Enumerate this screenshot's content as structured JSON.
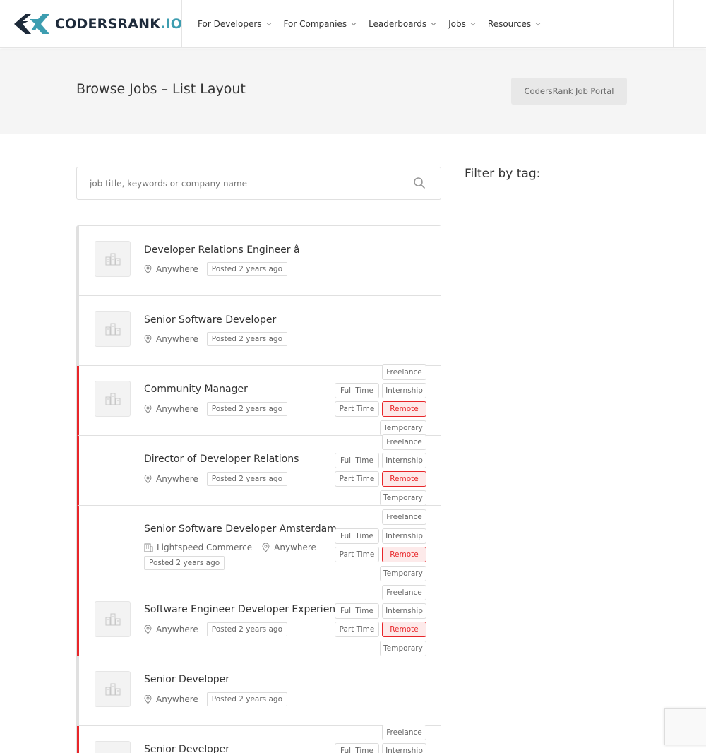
{
  "brand": {
    "name_main": "CODERSRANK",
    "name_suffix": ".IO"
  },
  "nav": [
    {
      "label": "For Developers"
    },
    {
      "label": "For Companies"
    },
    {
      "label": "Leaderboards"
    },
    {
      "label": "Jobs"
    },
    {
      "label": "Resources"
    }
  ],
  "page": {
    "title": "Browse Jobs – List Layout",
    "portal_button": "CodersRank Job Portal",
    "search_placeholder": "job title, keywords or company name",
    "filter_title": "Filter by tag:"
  },
  "tags": {
    "freelance": "Freelance",
    "full_time": "Full Time",
    "internship": "Internship",
    "part_time": "Part Time",
    "remote": "Remote",
    "temporary": "Temporary"
  },
  "colors": {
    "accent_red": "#e8262a",
    "brand_teal": "#3d9db0",
    "brand_navy": "#1d2a3a"
  },
  "jobs": [
    {
      "title": "Developer Relations Engineer â",
      "location": "Anywhere",
      "posted": "Posted 2 years ago",
      "featured": false,
      "has_logo": true
    },
    {
      "title": "Senior Software Developer",
      "location": "Anywhere",
      "posted": "Posted 2 years ago",
      "featured": false,
      "has_logo": true
    },
    {
      "title": "Community Manager",
      "location": "Anywhere",
      "posted": "Posted 2 years ago",
      "featured": true,
      "has_logo": true
    },
    {
      "title": "Director of Developer Relations",
      "location": "Anywhere",
      "posted": "Posted 2 years ago",
      "featured": true,
      "has_logo": false
    },
    {
      "title": "Senior Software Developer Amsterdam",
      "company": "Lightspeed Commerce",
      "location": "Anywhere",
      "posted": "Posted 2 years ago",
      "featured": true,
      "has_logo": false
    },
    {
      "title": "Software Engineer Developer Experience",
      "location": "Anywhere",
      "posted": "Posted 2 years ago",
      "featured": true,
      "has_logo": true
    },
    {
      "title": "Senior Developer",
      "location": "Anywhere",
      "posted": "Posted 2 years ago",
      "featured": false,
      "has_logo": true
    },
    {
      "title": "Senior Developer",
      "featured": true,
      "has_logo": true
    }
  ]
}
